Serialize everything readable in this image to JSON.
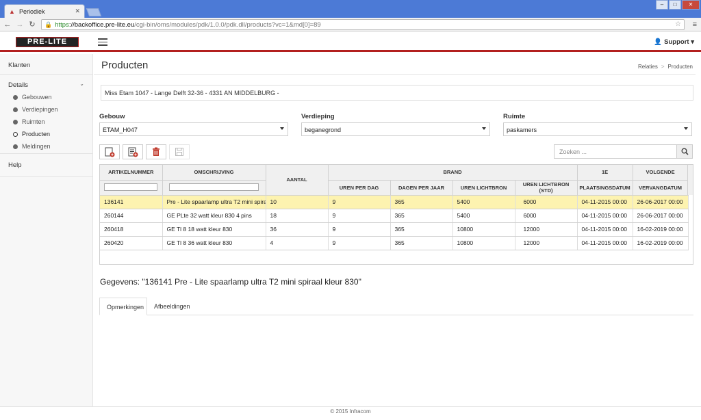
{
  "browser": {
    "tab_title": "Periodiek",
    "url_scheme": "https",
    "url_host": "://backoffice.pre-lite.eu",
    "url_path": "/cgi-bin/oms/modules/pdk/1.0.0/pdk.dll/products?vc=1&md[0]=89"
  },
  "header": {
    "logo_text": "PRE-LITE",
    "support_label": "Support"
  },
  "sidebar": {
    "top_item": "Klanten",
    "section_label": "Details",
    "items": [
      {
        "label": "Gebouwen"
      },
      {
        "label": "Verdiepingen"
      },
      {
        "label": "Ruimten"
      },
      {
        "label": "Producten"
      },
      {
        "label": "Meldingen"
      }
    ],
    "help_label": "Help"
  },
  "page": {
    "title": "Producten",
    "breadcrumb": {
      "parent": "Relaties",
      "current": "Producten"
    },
    "address": "Miss Etam 1047 - Lange Delft 32-36 - 4331 AN MIDDELBURG -"
  },
  "filters": {
    "gebouw": {
      "label": "Gebouw",
      "value": "ETAM_H047"
    },
    "verdieping": {
      "label": "Verdieping",
      "value": "beganegrond"
    },
    "ruimte": {
      "label": "Ruimte",
      "value": "paskamers"
    }
  },
  "search": {
    "placeholder": "Zoeken ..."
  },
  "grid": {
    "headers": {
      "artikelnummer": "ARTIKELNUMMER",
      "omschrijving": "OMSCHRIJVING",
      "aantal": "AANTAL",
      "brand": "BRAND",
      "eerste": "1E",
      "volgende": "VOLGENDE",
      "uren_per_dag": "UREN PER DAG",
      "dagen_per_jaar": "DAGEN PER JAAR",
      "uren_lichtbron": "UREN LICHTBRON",
      "uren_lichtbron_std": "UREN LICHTBRON (STD)",
      "plaatsingsdatum": "PLAATSINGSDATUM",
      "vervangdatum": "VERVANGDATUM"
    },
    "rows": [
      {
        "art": "136141",
        "omschr": "Pre - Lite spaarlamp ultra T2 mini spiraal kleur 830",
        "aantal": "10",
        "upd": "9",
        "dpj": "365",
        "ul": "5400",
        "uls": "6000",
        "plaats": "04-11-2015 00:00",
        "verv": "26-06-2017 00:00"
      },
      {
        "art": "260144",
        "omschr": "GE PLte 32 watt kleur 830 4 pins",
        "aantal": "18",
        "upd": "9",
        "dpj": "365",
        "ul": "5400",
        "uls": "6000",
        "plaats": "04-11-2015 00:00",
        "verv": "26-06-2017 00:00"
      },
      {
        "art": "260418",
        "omschr": "GE Tl 8 18 watt kleur 830",
        "aantal": "36",
        "upd": "9",
        "dpj": "365",
        "ul": "10800",
        "uls": "12000",
        "plaats": "04-11-2015 00:00",
        "verv": "16-02-2019 00:00"
      },
      {
        "art": "260420",
        "omschr": "GE Tl 8 36 watt kleur 830",
        "aantal": "4",
        "upd": "9",
        "dpj": "365",
        "ul": "10800",
        "uls": "12000",
        "plaats": "04-11-2015 00:00",
        "verv": "16-02-2019 00:00"
      }
    ]
  },
  "details": {
    "title": "Gegevens: \"136141 Pre - Lite spaarlamp ultra T2 mini spiraal kleur 830\"",
    "tabs": [
      {
        "label": "Opmerkingen"
      },
      {
        "label": "Afbeeldingen"
      }
    ]
  },
  "footer": {
    "text": "© 2015 Infracom"
  },
  "colors": {
    "brand_red": "#b3201f",
    "highlight_row": "#fdf3b0"
  }
}
